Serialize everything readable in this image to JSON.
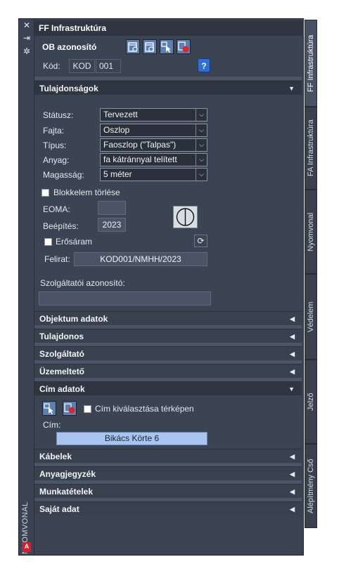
{
  "palette": {
    "title": "FF Infrastruktúra",
    "side_title": "NYOMVONAL",
    "controls": [
      "close-icon",
      "pin-icon",
      "properties-icon"
    ]
  },
  "header": {
    "ob_label": "OB azonosító",
    "kod_label": "Kód:",
    "kod_prefix": "KOD",
    "kod_number": "001",
    "help_label": "?"
  },
  "tulajdonsagok": {
    "title": "Tulajdonságok",
    "fields": [
      {
        "label": "Státusz:",
        "value": "Tervezett"
      },
      {
        "label": "Fajta:",
        "value": "Oszlop"
      },
      {
        "label": "Típus:",
        "value": "Faoszlop (\"Talpas\")"
      },
      {
        "label": "Anyag:",
        "value": "fa kátránnyal telített"
      },
      {
        "label": "Magasság:",
        "value": "5 méter"
      }
    ],
    "blokkelem_label": "Blokkelem törlése",
    "eoma_label": "EOMA:",
    "eoma_value": "",
    "beepites_label": "Beépítés:",
    "beepites_value": "2023",
    "erosaram_label": "Erősáram",
    "felirat_label": "Felirat:",
    "felirat_value": "KOD001/NMHH/2023",
    "szolg_azon_label": "Szolgáltatói azonosító:",
    "szolg_azon_value": ""
  },
  "sections": {
    "objektum": "Objektum adatok",
    "tulajdonos": "Tulajdonos",
    "szolgaltato": "Szolgáltató",
    "uzemelteto": "Üzemeltető",
    "cim_adatok": "Cím adatok",
    "kabelek": "Kábelek",
    "anyagjegyzek": "Anyagjegyzék",
    "munkatetelek": "Munkatételek",
    "sajat_adat": "Saját adat"
  },
  "cim": {
    "select_on_map_label": "Cím kiválasztása térképen",
    "cim_label": "Cím:",
    "cim_value": "Bikács Körte  6"
  },
  "side_tabs": [
    {
      "label": "FF Infrastruktúra",
      "active": true
    },
    {
      "label": "FA Infrastruktúra",
      "active": false
    },
    {
      "label": "Nyomvonal",
      "active": false
    },
    {
      "label": "Védelem",
      "active": false
    },
    {
      "label": "Jelző",
      "active": false
    },
    {
      "label": "Alépítmény Cső",
      "active": false
    }
  ],
  "colors": {
    "panel_bg": "#3b4453",
    "header_bg": "#2f3642",
    "input_bg": "#2b313b",
    "highlight": "#a8c4f0",
    "tool_blue": "#5b7fb0",
    "help_blue": "#2f6fd6",
    "logo_red": "#d51f2b"
  }
}
